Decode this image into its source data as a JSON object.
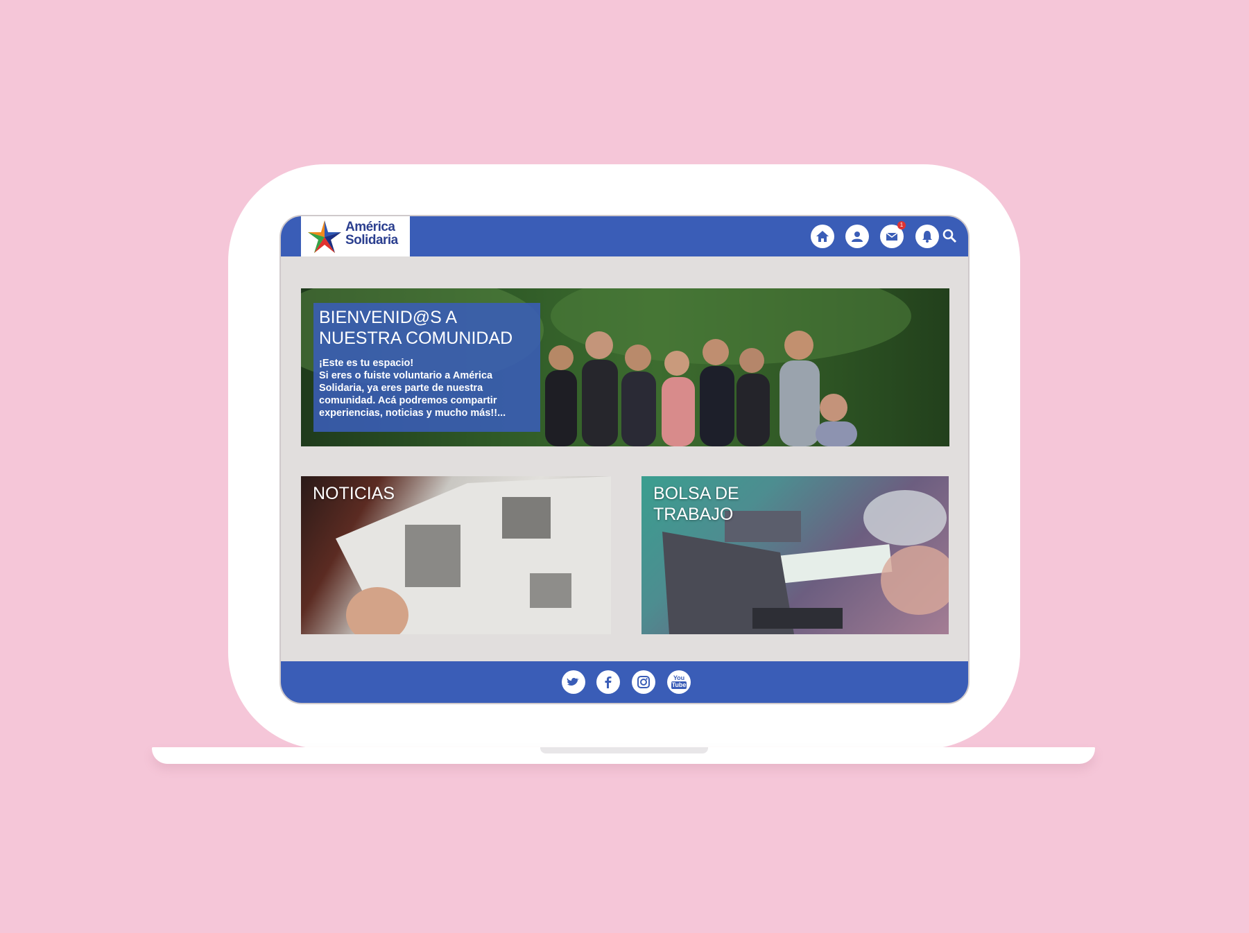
{
  "brand": {
    "name_line1": "América",
    "name_line2": "Solidaria",
    "primary_color": "#3a5db7",
    "background_color": "#f5c6d8"
  },
  "header": {
    "icons": [
      "home-icon",
      "profile-icon",
      "mail-icon",
      "bell-icon",
      "search-icon"
    ],
    "mail_badge": "1"
  },
  "hero": {
    "title": "BIENVENID@S A NUESTRA COMUNIDAD",
    "text": "¡Este es tu espacio!\nSi eres o fuiste voluntario a América Solidaria, ya eres parte de nuestra comunidad. Acá podremos compartir experiencias, noticias y mucho más!!..."
  },
  "cards": {
    "news": "NOTICIAS",
    "jobs": "BOLSA DE TRABAJO"
  },
  "footer": {
    "social": [
      "twitter-icon",
      "facebook-icon",
      "instagram-icon",
      "youtube-icon"
    ],
    "youtube_label_top": "You",
    "youtube_label_bottom": "Tube"
  }
}
